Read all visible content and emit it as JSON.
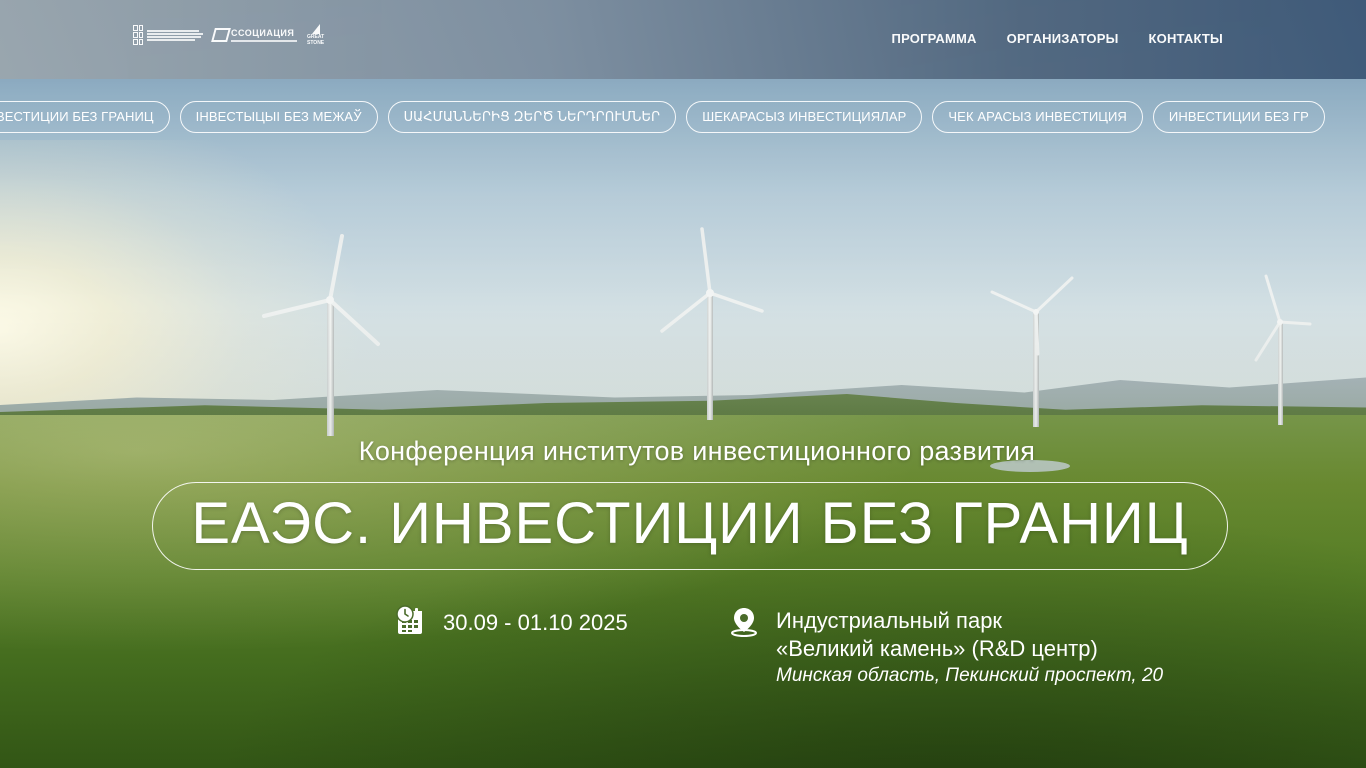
{
  "header": {
    "logos": {
      "logo1": "national-agency-logo",
      "logo2": {
        "text": "ССОЦИАЦИЯ"
      },
      "logo3": {
        "line1": "GREAT",
        "line2": "STONE"
      }
    },
    "nav": [
      {
        "label": "ПРОГРАММА"
      },
      {
        "label": "ОРГАНИЗАТОРЫ"
      },
      {
        "label": "КОНТАКТЫ"
      }
    ]
  },
  "marquee": [
    "ВЕСТИЦИИ БЕЗ ГРАНИЦ",
    "ІНВЕСТЫЦЫІ БЕЗ МЕЖАЎ",
    "ՍԱՀՄԱՆՆԵՐԻՑ ԶԵՐԾ ՆԵՐԴՐՈՒՄՆԵՐ",
    "ШЕКАРАСЫЗ ИНВЕСТИЦИЯЛАР",
    "ЧЕК АРАСЫЗ ИНВЕСТИЦИЯ",
    "ИНВЕСТИЦИИ БЕЗ ГР"
  ],
  "hero": {
    "subtitle": "Конференция институтов инвестиционного развития",
    "title": "ЕАЭС. ИНВЕСТИЦИИ БЕЗ ГРАНИЦ",
    "date": "30.09 - 01.10 2025",
    "location": {
      "line1": "Индустриальный парк",
      "line2": "«Великий камень» (R&D центр)",
      "line3": "Минская область, Пекинский проспект, 20"
    }
  },
  "icons": {
    "date": "calendar-clock-icon",
    "location": "map-pin-icon"
  },
  "colors": {
    "header_left": "#9aa6ae",
    "header_right": "#3d5877",
    "field": "#5f8a2a",
    "text": "#ffffff"
  }
}
